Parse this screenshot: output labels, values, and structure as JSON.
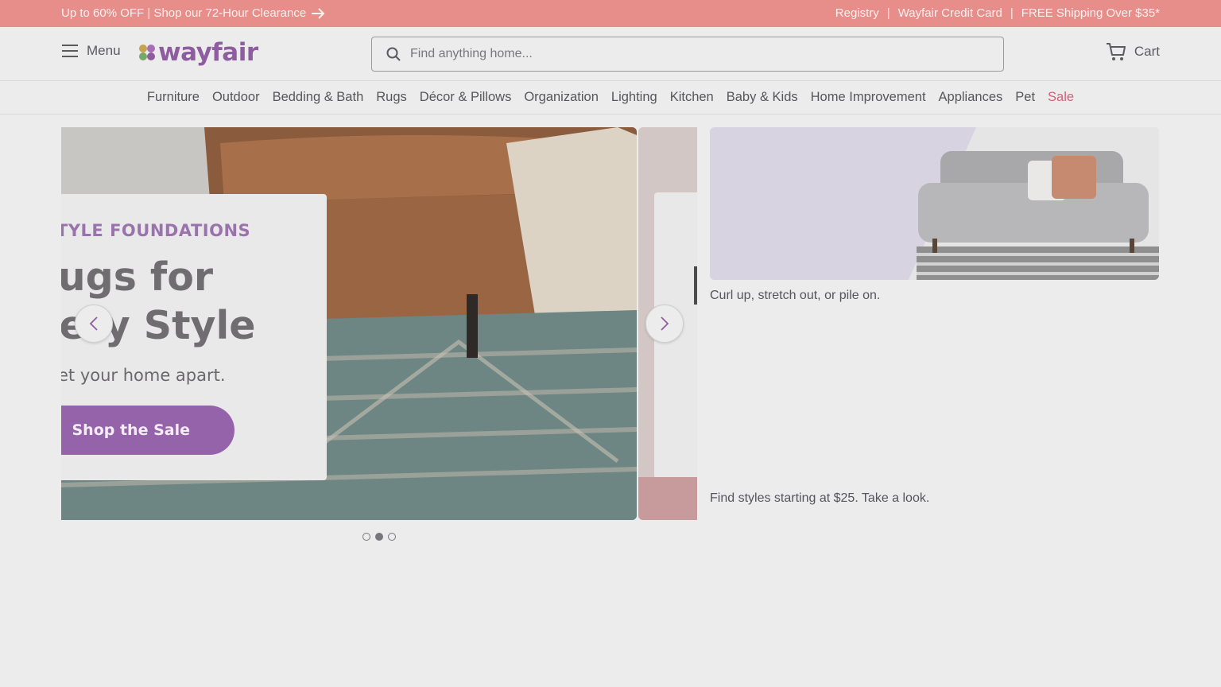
{
  "promo_bar": {
    "left_text": "Up to 60% OFF | Shop our 72-Hour Clearance",
    "links": [
      "Registry",
      "Wayfair Credit Card",
      "FREE Shipping Over $35*"
    ],
    "separator": "|"
  },
  "header": {
    "menu_label": "Menu",
    "logo_text": "wayfair",
    "search_placeholder": "Find anything home...",
    "cart_label": "Cart"
  },
  "categories": [
    "Furniture",
    "Outdoor",
    "Bedding & Bath",
    "Rugs",
    "Décor & Pillows",
    "Organization",
    "Lighting",
    "Kitchen",
    "Baby & Kids",
    "Home Improvement",
    "Appliances",
    "Pet",
    "Sale"
  ],
  "hero": {
    "kicker": "TYLE FOUNDATIONS",
    "headline_line1": "Rugs for",
    "headline_line2": "Every Style",
    "subtext": "et your home apart.",
    "cta_label": "Shop the Sale",
    "slide_count": 3,
    "active_slide": 2
  },
  "side": {
    "caption1": "Curl up, stretch out, or pile on.",
    "caption2": "Find styles starting at $25. Take a look."
  },
  "colors": {
    "promo_bg": "#e78e8a",
    "brand_purple": "#8e5d9f",
    "sale_red": "#d0607a"
  }
}
